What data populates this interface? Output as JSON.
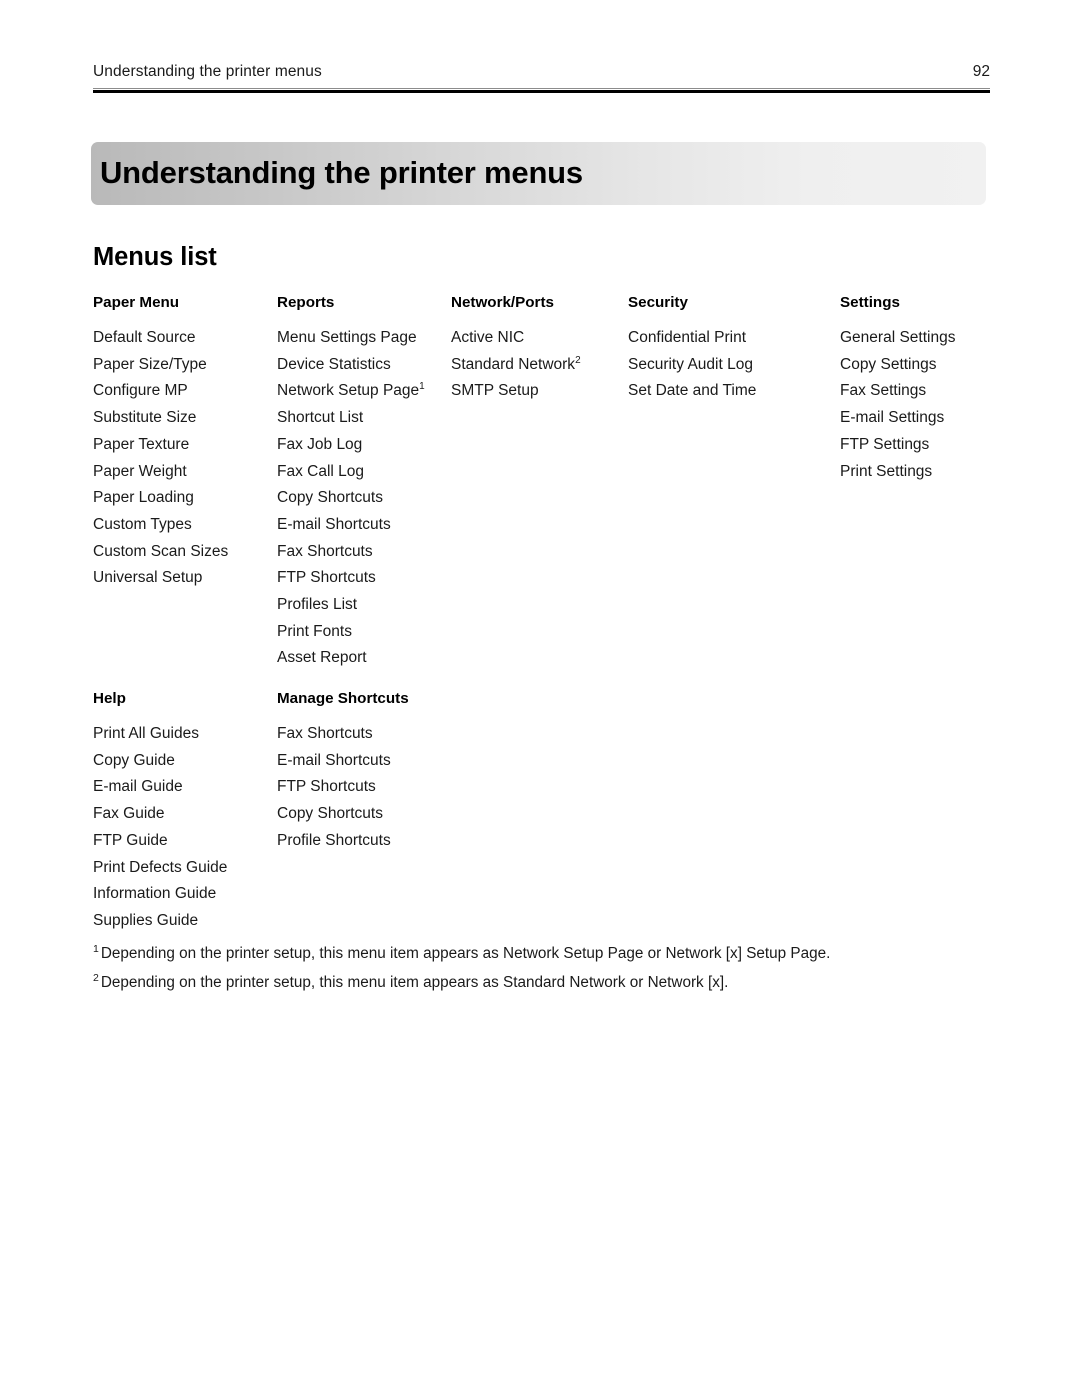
{
  "header": {
    "running_title": "Understanding the printer menus",
    "page_number": "92"
  },
  "chapter": {
    "title": "Understanding the printer menus"
  },
  "section": {
    "title": "Menus list"
  },
  "menu_columns_top": [
    {
      "heading": "Paper Menu",
      "items": [
        "Default Source",
        "Paper Size/Type",
        "Configure MP",
        "Substitute Size",
        "Paper Texture",
        "Paper Weight",
        "Paper Loading",
        "Custom Types",
        "Custom Scan Sizes",
        "Universal Setup"
      ]
    },
    {
      "heading": "Reports",
      "items": [
        "Menu Settings Page",
        "Device Statistics",
        "Network Setup Page",
        "Shortcut List",
        "Fax Job Log",
        "Fax Call Log",
        "Copy Shortcuts",
        "E-mail Shortcuts",
        "Fax Shortcuts",
        "FTP Shortcuts",
        "Profiles List",
        "Print Fonts",
        "Asset Report"
      ],
      "footnote_marks": {
        "2": "1"
      }
    },
    {
      "heading": "Network/Ports",
      "items": [
        "Active NIC",
        "Standard Network",
        "SMTP Setup"
      ],
      "footnote_marks": {
        "1": "2"
      }
    },
    {
      "heading": "Security",
      "items": [
        "Confidential Print",
        "Security Audit Log",
        "Set Date and Time"
      ]
    },
    {
      "heading": "Settings",
      "items": [
        "General Settings",
        "Copy Settings",
        "Fax Settings",
        "E-mail Settings",
        "FTP Settings",
        "Print Settings"
      ]
    }
  ],
  "menu_columns_bottom": [
    {
      "heading": "Help",
      "items": [
        "Print All Guides",
        "Copy Guide",
        "E-mail Guide",
        "Fax Guide",
        "FTP Guide",
        "Print Defects Guide",
        "Information Guide",
        "Supplies Guide"
      ]
    },
    {
      "heading": "Manage Shortcuts",
      "items": [
        "Fax Shortcuts",
        "E-mail Shortcuts",
        "FTP Shortcuts",
        "Copy Shortcuts",
        "Profile Shortcuts"
      ]
    }
  ],
  "footnotes": [
    {
      "marker": "1",
      "text": "Depending on the printer setup, this menu item appears as Network Setup Page or Network [x] Setup Page."
    },
    {
      "marker": "2",
      "text": "Depending on the printer setup, this menu item appears as Standard Network or Network [x]."
    }
  ],
  "colors": {
    "text": "#1a1a1a",
    "rule": "#000000",
    "banner_start": "#b9b9b9",
    "banner_end": "#f1f1f1"
  }
}
